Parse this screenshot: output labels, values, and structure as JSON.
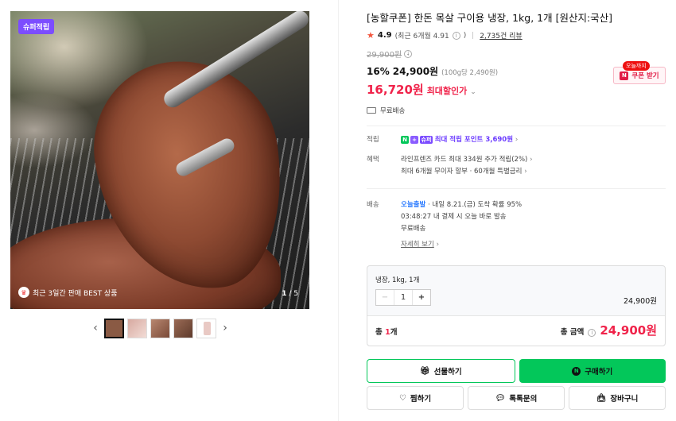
{
  "gallery": {
    "badge": "슈퍼적립",
    "best_label": "최근 3일간 판매 BEST 상품",
    "counter_current": "1",
    "counter_total": "5",
    "counter_sep": " / ",
    "prev_arrow": "‹",
    "next_arrow": "›"
  },
  "product": {
    "title": "[농할쿠폰] 한돈 목살 구이용 냉장, 1kg, 1개 [원산지:국산]",
    "rating": "4.9",
    "rating_detail": "(최근 6개월 4.91",
    "rating_detail_end": ")",
    "review_count": "2,735건 리뷰",
    "original_price": "29,900원",
    "discount_rate": "16%",
    "sale_price": "24,900원",
    "unit_price": "(100g당 2,490원)",
    "max_discount_price": "16,720원",
    "max_discount_label": "최대할인가",
    "shipping": "무료배송"
  },
  "coupon": {
    "tag": "오늘까지",
    "icon": "N",
    "label": "쿠폰 받기"
  },
  "points": {
    "label": "적립",
    "badge_n": "N",
    "badge_plus": "+",
    "badge_super": "슈퍼",
    "text": "최대 적립 포인트 3,690원"
  },
  "benefits": {
    "label": "혜택",
    "line1": "라인프렌즈 카드 최대 334원 추가 적립(2%)",
    "line2": "최대 6개월 무이자 할부 · 60개월 특별금리"
  },
  "delivery": {
    "label": "배송",
    "arrival_tag": "오늘출발",
    "arrival_text": " · 내일 8.21.(금) 도착 확률 95%",
    "cutoff": "03:48:27 내 결제 시 오늘 바로 발송",
    "fee": "무료배송",
    "detail_link": "자세히 보기"
  },
  "option": {
    "name": "냉장, 1kg, 1개",
    "minus": "−",
    "quantity": "1",
    "plus": "+",
    "price": "24,900원"
  },
  "total": {
    "qty_prefix": "총 ",
    "qty_count": "1",
    "qty_suffix": "개",
    "label": "총 금액",
    "amount": "24,900원"
  },
  "buttons": {
    "gift": "선물하기",
    "buy": "구매하기",
    "wish": "찜하기",
    "talk": "톡톡문의",
    "cart": "장바구니"
  },
  "colors": {
    "accent_red": "#f0234a",
    "naver_green": "#03c75a",
    "super_purple": "#7c4dff"
  }
}
